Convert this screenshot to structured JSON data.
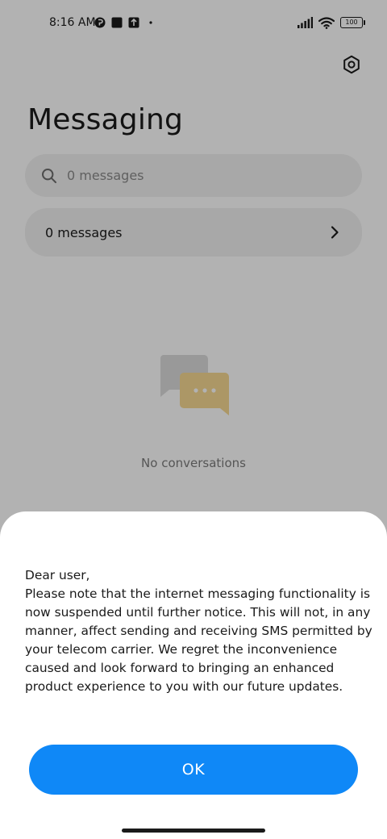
{
  "status_bar": {
    "time": "8:16 AM",
    "battery": "100",
    "icons": [
      "circle-p-icon",
      "square-icon",
      "upload-icon",
      "dot-icon",
      "signal-icon",
      "wifi-icon",
      "battery-icon"
    ]
  },
  "header": {
    "title": "Messaging",
    "settings_icon": "gear-icon"
  },
  "search": {
    "placeholder": "0 messages",
    "value": ""
  },
  "summary": {
    "label": "0 messages"
  },
  "empty_state": {
    "text": "No conversations"
  },
  "dialog": {
    "message": "Dear user,\nPlease note that the internet messaging functionality is now suspended until further notice. This will not, in any manner, affect sending and receiving SMS permitted by your telecom carrier. We regret the inconvenience caused and look forward to bringing an enhanced product experience to you with our future updates.",
    "ok_label": "OK"
  },
  "colors": {
    "accent": "#0f88f7",
    "overlay": "#000000",
    "illustration_back": "#d9d9d9",
    "illustration_front": "#f5d999"
  }
}
